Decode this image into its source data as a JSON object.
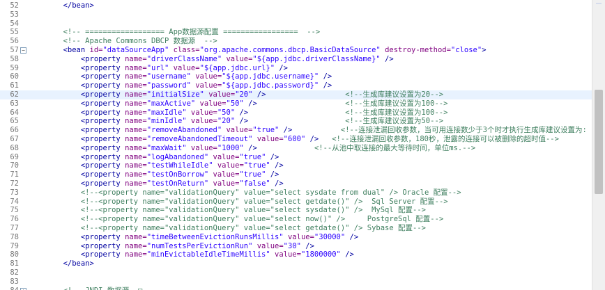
{
  "editor": {
    "lines": [
      {
        "num": "52",
        "spans": [
          [
            "        ",
            "t"
          ],
          [
            "</bean>",
            "tag"
          ]
        ]
      },
      {
        "num": "53",
        "spans": []
      },
      {
        "num": "54",
        "spans": []
      },
      {
        "num": "55",
        "spans": [
          [
            "        ",
            "t"
          ],
          [
            "<!-- ================== App数据源配置 =================  -->",
            "com"
          ]
        ]
      },
      {
        "num": "56",
        "spans": [
          [
            "        ",
            "t"
          ],
          [
            "<!-- Apache Commons DBCP 数据源  -->",
            "com"
          ]
        ]
      },
      {
        "num": "57",
        "fold": "⊖",
        "spans": [
          [
            "        ",
            "t"
          ],
          [
            "<bean ",
            "tag"
          ],
          [
            "id=",
            "attr"
          ],
          [
            "\"dataSourceApp\"",
            "val"
          ],
          [
            " class=",
            "attr"
          ],
          [
            "\"org.apache.commons.dbcp.BasicDataSource\"",
            "val"
          ],
          [
            " destroy-method=",
            "attr"
          ],
          [
            "\"close\"",
            "val"
          ],
          [
            ">",
            "tag"
          ]
        ]
      },
      {
        "num": "58",
        "spans": [
          [
            "            ",
            "t"
          ],
          [
            "<property ",
            "tag"
          ],
          [
            "name=",
            "attr"
          ],
          [
            "\"driverClassName\"",
            "val"
          ],
          [
            " value=",
            "attr"
          ],
          [
            "\"${app.jdbc.driverClassName}\"",
            "val"
          ],
          [
            " />",
            "tag"
          ]
        ]
      },
      {
        "num": "59",
        "spans": [
          [
            "            ",
            "t"
          ],
          [
            "<property ",
            "tag"
          ],
          [
            "name=",
            "attr"
          ],
          [
            "\"url\"",
            "val"
          ],
          [
            " value=",
            "attr"
          ],
          [
            "\"${app.jdbc.url}\"",
            "val"
          ],
          [
            " />",
            "tag"
          ]
        ]
      },
      {
        "num": "60",
        "spans": [
          [
            "            ",
            "t"
          ],
          [
            "<property ",
            "tag"
          ],
          [
            "name=",
            "attr"
          ],
          [
            "\"username\"",
            "val"
          ],
          [
            " value=",
            "attr"
          ],
          [
            "\"${app.jdbc.username}\"",
            "val"
          ],
          [
            " />",
            "tag"
          ]
        ]
      },
      {
        "num": "61",
        "spans": [
          [
            "            ",
            "t"
          ],
          [
            "<property ",
            "tag"
          ],
          [
            "name=",
            "attr"
          ],
          [
            "\"password\"",
            "val"
          ],
          [
            " value=",
            "attr"
          ],
          [
            "\"${app.jdbc.password}\"",
            "val"
          ],
          [
            " />",
            "tag"
          ]
        ]
      },
      {
        "num": "62",
        "current": true,
        "spans": [
          [
            "            ",
            "t"
          ],
          [
            "<property ",
            "tag"
          ],
          [
            "name=",
            "attr"
          ],
          [
            "\"initialSize\"",
            "val"
          ],
          [
            " value=",
            "attr"
          ],
          [
            "\"20\"",
            "val"
          ],
          [
            " />",
            "tag"
          ],
          [
            "                  ",
            "t"
          ],
          [
            "<!--生成库建议设置为20-->",
            "com"
          ]
        ]
      },
      {
        "num": "63",
        "spans": [
          [
            "            ",
            "t"
          ],
          [
            "<property ",
            "tag"
          ],
          [
            "name=",
            "attr"
          ],
          [
            "\"maxActive\"",
            "val"
          ],
          [
            " value=",
            "attr"
          ],
          [
            "\"50\"",
            "val"
          ],
          [
            " />",
            "tag"
          ],
          [
            "                    ",
            "t"
          ],
          [
            "<!--生成库建议设置为100-->",
            "com"
          ]
        ]
      },
      {
        "num": "64",
        "spans": [
          [
            "            ",
            "t"
          ],
          [
            "<property ",
            "tag"
          ],
          [
            "name=",
            "attr"
          ],
          [
            "\"maxIdle\"",
            "val"
          ],
          [
            " value=",
            "attr"
          ],
          [
            "\"50\"",
            "val"
          ],
          [
            " />",
            "tag"
          ],
          [
            "                      ",
            "t"
          ],
          [
            "<!--生成库建议设置为100-->",
            "com"
          ]
        ]
      },
      {
        "num": "65",
        "spans": [
          [
            "            ",
            "t"
          ],
          [
            "<property ",
            "tag"
          ],
          [
            "name=",
            "attr"
          ],
          [
            "\"minIdle\"",
            "val"
          ],
          [
            " value=",
            "attr"
          ],
          [
            "\"20\"",
            "val"
          ],
          [
            " />",
            "tag"
          ],
          [
            "                      ",
            "t"
          ],
          [
            "<!--生成库建议设置为50-->",
            "com"
          ]
        ]
      },
      {
        "num": "66",
        "spans": [
          [
            "            ",
            "t"
          ],
          [
            "<property ",
            "tag"
          ],
          [
            "name=",
            "attr"
          ],
          [
            "\"removeAbandoned\"",
            "val"
          ],
          [
            " value=",
            "attr"
          ],
          [
            "\"true\"",
            "val"
          ],
          [
            " />",
            "tag"
          ],
          [
            "           ",
            "t"
          ],
          [
            "<!--连接泄漏回收参数，当可用连接数少于3个时才执行生成库建议设置为:",
            "com"
          ]
        ]
      },
      {
        "num": "67",
        "spans": [
          [
            "            ",
            "t"
          ],
          [
            "<property ",
            "tag"
          ],
          [
            "name=",
            "attr"
          ],
          [
            "\"removeAbandonedTimeout\"",
            "val"
          ],
          [
            " value=",
            "attr"
          ],
          [
            "\"600\"",
            "val"
          ],
          [
            " />",
            "tag"
          ],
          [
            "   ",
            "t"
          ],
          [
            "<!--连接泄漏回收参数，180秒，泄露的连接可以被删除的超时值-->",
            "com"
          ]
        ]
      },
      {
        "num": "68",
        "spans": [
          [
            "            ",
            "t"
          ],
          [
            "<property ",
            "tag"
          ],
          [
            "name=",
            "attr"
          ],
          [
            "\"maxWait\"",
            "val"
          ],
          [
            " value=",
            "attr"
          ],
          [
            "\"1000\"",
            "val"
          ],
          [
            " />",
            "tag"
          ],
          [
            "             ",
            "t"
          ],
          [
            "<!--从池中取连接的最大等待时间，单位ms.-->",
            "com"
          ]
        ]
      },
      {
        "num": "69",
        "spans": [
          [
            "            ",
            "t"
          ],
          [
            "<property ",
            "tag"
          ],
          [
            "name=",
            "attr"
          ],
          [
            "\"logAbandoned\"",
            "val"
          ],
          [
            " value=",
            "attr"
          ],
          [
            "\"true\"",
            "val"
          ],
          [
            " />",
            "tag"
          ]
        ]
      },
      {
        "num": "70",
        "spans": [
          [
            "            ",
            "t"
          ],
          [
            "<property ",
            "tag"
          ],
          [
            "name=",
            "attr"
          ],
          [
            "\"testWhileIdle\"",
            "val"
          ],
          [
            " value=",
            "attr"
          ],
          [
            "\"true\"",
            "val"
          ],
          [
            " />",
            "tag"
          ]
        ]
      },
      {
        "num": "71",
        "spans": [
          [
            "            ",
            "t"
          ],
          [
            "<property ",
            "tag"
          ],
          [
            "name=",
            "attr"
          ],
          [
            "\"testOnBorrow\"",
            "val"
          ],
          [
            " value=",
            "attr"
          ],
          [
            "\"true\"",
            "val"
          ],
          [
            " />",
            "tag"
          ]
        ]
      },
      {
        "num": "72",
        "spans": [
          [
            "            ",
            "t"
          ],
          [
            "<property ",
            "tag"
          ],
          [
            "name=",
            "attr"
          ],
          [
            "\"testOnReturn\"",
            "val"
          ],
          [
            " value=",
            "attr"
          ],
          [
            "\"false\"",
            "val"
          ],
          [
            " />",
            "tag"
          ]
        ]
      },
      {
        "num": "73",
        "spans": [
          [
            "            ",
            "t"
          ],
          [
            "<!--<property name=\"validationQuery\" value=\"select sysdate from dual\" /> Oracle 配置-->",
            "com"
          ]
        ]
      },
      {
        "num": "74",
        "spans": [
          [
            "            ",
            "t"
          ],
          [
            "<!--<property name=\"validationQuery\" value=\"select getdate()\" />  Sql Server 配置-->",
            "com"
          ]
        ]
      },
      {
        "num": "75",
        "spans": [
          [
            "            ",
            "t"
          ],
          [
            "<!--<property name=\"validationQuery\" value=\"select sysdate()\" />  MySql 配置-->",
            "com"
          ]
        ]
      },
      {
        "num": "76",
        "spans": [
          [
            "            ",
            "t"
          ],
          [
            "<!--<property name=\"validationQuery\" value=\"select now()\" />     PostgreSql 配置-->",
            "com"
          ]
        ]
      },
      {
        "num": "77",
        "spans": [
          [
            "            ",
            "t"
          ],
          [
            "<!--<property name=\"validationQuery\" value=\"select getdate()\" /> Sybase 配置-->",
            "com"
          ]
        ]
      },
      {
        "num": "78",
        "spans": [
          [
            "            ",
            "t"
          ],
          [
            "<property ",
            "tag"
          ],
          [
            "name=",
            "attr"
          ],
          [
            "\"timeBetweenEvictionRunsMillis\"",
            "val"
          ],
          [
            " value=",
            "attr"
          ],
          [
            "\"30000\"",
            "val"
          ],
          [
            " />",
            "tag"
          ]
        ]
      },
      {
        "num": "79",
        "spans": [
          [
            "            ",
            "t"
          ],
          [
            "<property ",
            "tag"
          ],
          [
            "name=",
            "attr"
          ],
          [
            "\"numTestsPerEvictionRun\"",
            "val"
          ],
          [
            " value=",
            "attr"
          ],
          [
            "\"30\"",
            "val"
          ],
          [
            " />",
            "tag"
          ]
        ]
      },
      {
        "num": "80",
        "spans": [
          [
            "            ",
            "t"
          ],
          [
            "<property ",
            "tag"
          ],
          [
            "name=",
            "attr"
          ],
          [
            "\"minEvictableIdleTimeMillis\"",
            "val"
          ],
          [
            " value=",
            "attr"
          ],
          [
            "\"1800000\"",
            "val"
          ],
          [
            " />",
            "tag"
          ]
        ]
      },
      {
        "num": "81",
        "spans": [
          [
            "        ",
            "t"
          ],
          [
            "</bean>",
            "tag"
          ]
        ]
      },
      {
        "num": "82",
        "spans": []
      },
      {
        "num": "83",
        "spans": []
      },
      {
        "num": "84",
        "fold": "⊕",
        "spans": [
          [
            "        ",
            "t"
          ],
          [
            "<!-- JNDI 数据源  ",
            "com"
          ],
          [
            "□",
            "com"
          ]
        ]
      }
    ]
  },
  "scrollbar": {
    "thumb_position": 0.31,
    "thumb_size": 0.36
  }
}
